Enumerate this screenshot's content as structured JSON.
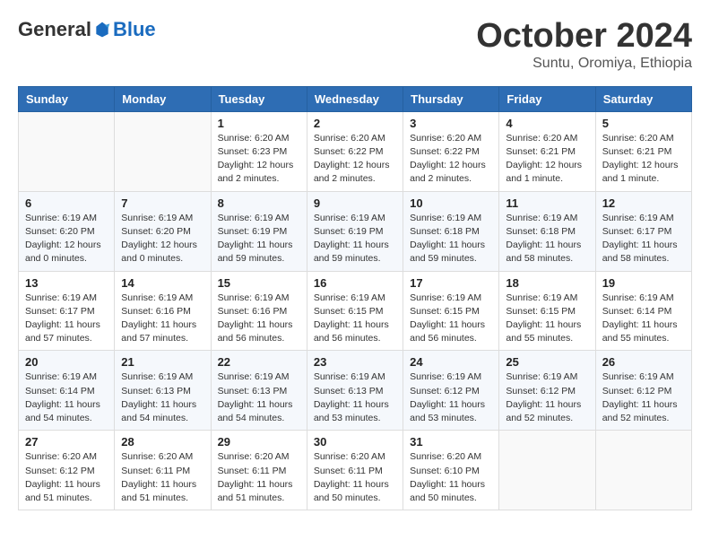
{
  "header": {
    "logo_general": "General",
    "logo_blue": "Blue",
    "month_title": "October 2024",
    "location": "Suntu, Oromiya, Ethiopia"
  },
  "weekdays": [
    "Sunday",
    "Monday",
    "Tuesday",
    "Wednesday",
    "Thursday",
    "Friday",
    "Saturday"
  ],
  "weeks": [
    [
      {
        "day": "",
        "info": ""
      },
      {
        "day": "",
        "info": ""
      },
      {
        "day": "1",
        "info": "Sunrise: 6:20 AM\nSunset: 6:23 PM\nDaylight: 12 hours and 2 minutes."
      },
      {
        "day": "2",
        "info": "Sunrise: 6:20 AM\nSunset: 6:22 PM\nDaylight: 12 hours and 2 minutes."
      },
      {
        "day": "3",
        "info": "Sunrise: 6:20 AM\nSunset: 6:22 PM\nDaylight: 12 hours and 2 minutes."
      },
      {
        "day": "4",
        "info": "Sunrise: 6:20 AM\nSunset: 6:21 PM\nDaylight: 12 hours and 1 minute."
      },
      {
        "day": "5",
        "info": "Sunrise: 6:20 AM\nSunset: 6:21 PM\nDaylight: 12 hours and 1 minute."
      }
    ],
    [
      {
        "day": "6",
        "info": "Sunrise: 6:19 AM\nSunset: 6:20 PM\nDaylight: 12 hours and 0 minutes."
      },
      {
        "day": "7",
        "info": "Sunrise: 6:19 AM\nSunset: 6:20 PM\nDaylight: 12 hours and 0 minutes."
      },
      {
        "day": "8",
        "info": "Sunrise: 6:19 AM\nSunset: 6:19 PM\nDaylight: 11 hours and 59 minutes."
      },
      {
        "day": "9",
        "info": "Sunrise: 6:19 AM\nSunset: 6:19 PM\nDaylight: 11 hours and 59 minutes."
      },
      {
        "day": "10",
        "info": "Sunrise: 6:19 AM\nSunset: 6:18 PM\nDaylight: 11 hours and 59 minutes."
      },
      {
        "day": "11",
        "info": "Sunrise: 6:19 AM\nSunset: 6:18 PM\nDaylight: 11 hours and 58 minutes."
      },
      {
        "day": "12",
        "info": "Sunrise: 6:19 AM\nSunset: 6:17 PM\nDaylight: 11 hours and 58 minutes."
      }
    ],
    [
      {
        "day": "13",
        "info": "Sunrise: 6:19 AM\nSunset: 6:17 PM\nDaylight: 11 hours and 57 minutes."
      },
      {
        "day": "14",
        "info": "Sunrise: 6:19 AM\nSunset: 6:16 PM\nDaylight: 11 hours and 57 minutes."
      },
      {
        "day": "15",
        "info": "Sunrise: 6:19 AM\nSunset: 6:16 PM\nDaylight: 11 hours and 56 minutes."
      },
      {
        "day": "16",
        "info": "Sunrise: 6:19 AM\nSunset: 6:15 PM\nDaylight: 11 hours and 56 minutes."
      },
      {
        "day": "17",
        "info": "Sunrise: 6:19 AM\nSunset: 6:15 PM\nDaylight: 11 hours and 56 minutes."
      },
      {
        "day": "18",
        "info": "Sunrise: 6:19 AM\nSunset: 6:15 PM\nDaylight: 11 hours and 55 minutes."
      },
      {
        "day": "19",
        "info": "Sunrise: 6:19 AM\nSunset: 6:14 PM\nDaylight: 11 hours and 55 minutes."
      }
    ],
    [
      {
        "day": "20",
        "info": "Sunrise: 6:19 AM\nSunset: 6:14 PM\nDaylight: 11 hours and 54 minutes."
      },
      {
        "day": "21",
        "info": "Sunrise: 6:19 AM\nSunset: 6:13 PM\nDaylight: 11 hours and 54 minutes."
      },
      {
        "day": "22",
        "info": "Sunrise: 6:19 AM\nSunset: 6:13 PM\nDaylight: 11 hours and 54 minutes."
      },
      {
        "day": "23",
        "info": "Sunrise: 6:19 AM\nSunset: 6:13 PM\nDaylight: 11 hours and 53 minutes."
      },
      {
        "day": "24",
        "info": "Sunrise: 6:19 AM\nSunset: 6:12 PM\nDaylight: 11 hours and 53 minutes."
      },
      {
        "day": "25",
        "info": "Sunrise: 6:19 AM\nSunset: 6:12 PM\nDaylight: 11 hours and 52 minutes."
      },
      {
        "day": "26",
        "info": "Sunrise: 6:19 AM\nSunset: 6:12 PM\nDaylight: 11 hours and 52 minutes."
      }
    ],
    [
      {
        "day": "27",
        "info": "Sunrise: 6:20 AM\nSunset: 6:12 PM\nDaylight: 11 hours and 51 minutes."
      },
      {
        "day": "28",
        "info": "Sunrise: 6:20 AM\nSunset: 6:11 PM\nDaylight: 11 hours and 51 minutes."
      },
      {
        "day": "29",
        "info": "Sunrise: 6:20 AM\nSunset: 6:11 PM\nDaylight: 11 hours and 51 minutes."
      },
      {
        "day": "30",
        "info": "Sunrise: 6:20 AM\nSunset: 6:11 PM\nDaylight: 11 hours and 50 minutes."
      },
      {
        "day": "31",
        "info": "Sunrise: 6:20 AM\nSunset: 6:10 PM\nDaylight: 11 hours and 50 minutes."
      },
      {
        "day": "",
        "info": ""
      },
      {
        "day": "",
        "info": ""
      }
    ]
  ]
}
